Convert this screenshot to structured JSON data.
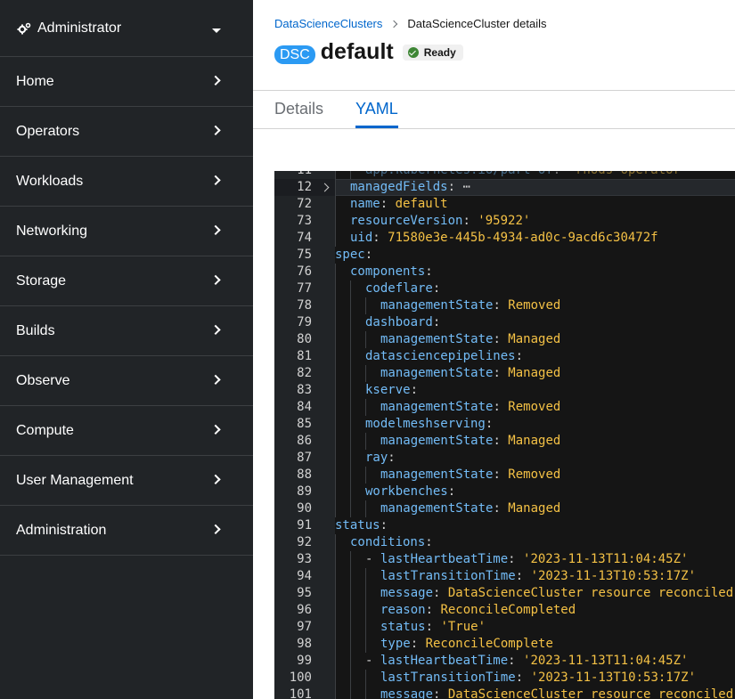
{
  "sidebar": {
    "perspective": "Administrator",
    "items": [
      {
        "label": "Home"
      },
      {
        "label": "Operators"
      },
      {
        "label": "Workloads"
      },
      {
        "label": "Networking"
      },
      {
        "label": "Storage"
      },
      {
        "label": "Builds"
      },
      {
        "label": "Observe"
      },
      {
        "label": "Compute"
      },
      {
        "label": "User Management"
      },
      {
        "label": "Administration"
      }
    ]
  },
  "breadcrumb": {
    "parent": "DataScienceClusters",
    "current": "DataScienceCluster details"
  },
  "header": {
    "badge": "DSC",
    "title": "default",
    "status": "Ready"
  },
  "tabs": [
    {
      "label": "Details",
      "active": false
    },
    {
      "label": "YAML",
      "active": true
    }
  ],
  "yaml": {
    "lines": [
      {
        "num": "11",
        "indent": 2,
        "key": "app.kubernetes.io/part-of",
        "value": "'rhods-operator'",
        "type": "string",
        "partial": true
      },
      {
        "num": "12",
        "indent": 1,
        "key": "managedFields",
        "value": "⋯",
        "type": "plain",
        "folded": true,
        "highlight": true
      },
      {
        "num": "72",
        "indent": 1,
        "key": "name",
        "value": "default",
        "type": "string"
      },
      {
        "num": "73",
        "indent": 1,
        "key": "resourceVersion",
        "value": "'95922'",
        "type": "string"
      },
      {
        "num": "74",
        "indent": 1,
        "key": "uid",
        "value": "71580e3e-445b-4934-ad0c-9acd6c30472f",
        "type": "string"
      },
      {
        "num": "75",
        "indent": 0,
        "key": "spec",
        "value": "",
        "type": "none"
      },
      {
        "num": "76",
        "indent": 1,
        "key": "components",
        "value": "",
        "type": "none"
      },
      {
        "num": "77",
        "indent": 2,
        "key": "codeflare",
        "value": "",
        "type": "none"
      },
      {
        "num": "78",
        "indent": 3,
        "key": "managementState",
        "value": "Removed",
        "type": "string"
      },
      {
        "num": "79",
        "indent": 2,
        "key": "dashboard",
        "value": "",
        "type": "none"
      },
      {
        "num": "80",
        "indent": 3,
        "key": "managementState",
        "value": "Managed",
        "type": "string"
      },
      {
        "num": "81",
        "indent": 2,
        "key": "datasciencepipelines",
        "value": "",
        "type": "none"
      },
      {
        "num": "82",
        "indent": 3,
        "key": "managementState",
        "value": "Managed",
        "type": "string"
      },
      {
        "num": "83",
        "indent": 2,
        "key": "kserve",
        "value": "",
        "type": "none"
      },
      {
        "num": "84",
        "indent": 3,
        "key": "managementState",
        "value": "Removed",
        "type": "string"
      },
      {
        "num": "85",
        "indent": 2,
        "key": "modelmeshserving",
        "value": "",
        "type": "none"
      },
      {
        "num": "86",
        "indent": 3,
        "key": "managementState",
        "value": "Managed",
        "type": "string"
      },
      {
        "num": "87",
        "indent": 2,
        "key": "ray",
        "value": "",
        "type": "none"
      },
      {
        "num": "88",
        "indent": 3,
        "key": "managementState",
        "value": "Removed",
        "type": "string"
      },
      {
        "num": "89",
        "indent": 2,
        "key": "workbenches",
        "value": "",
        "type": "none"
      },
      {
        "num": "90",
        "indent": 3,
        "key": "managementState",
        "value": "Managed",
        "type": "string"
      },
      {
        "num": "91",
        "indent": 0,
        "key": "status",
        "value": "",
        "type": "none"
      },
      {
        "num": "92",
        "indent": 1,
        "key": "conditions",
        "value": "",
        "type": "none"
      },
      {
        "num": "93",
        "indent": 2,
        "dash": true,
        "key": "lastHeartbeatTime",
        "value": "'2023-11-13T11:04:45Z'",
        "type": "string"
      },
      {
        "num": "94",
        "indent": 3,
        "key": "lastTransitionTime",
        "value": "'2023-11-13T10:53:17Z'",
        "type": "string"
      },
      {
        "num": "95",
        "indent": 3,
        "key": "message",
        "value": "DataScienceCluster resource reconciled",
        "type": "string"
      },
      {
        "num": "96",
        "indent": 3,
        "key": "reason",
        "value": "ReconcileCompleted",
        "type": "string"
      },
      {
        "num": "97",
        "indent": 3,
        "key": "status",
        "value": "'True'",
        "type": "string"
      },
      {
        "num": "98",
        "indent": 3,
        "key": "type",
        "value": "ReconcileComplete",
        "type": "string"
      },
      {
        "num": "99",
        "indent": 2,
        "dash": true,
        "key": "lastHeartbeatTime",
        "value": "'2023-11-13T11:04:45Z'",
        "type": "string"
      },
      {
        "num": "100",
        "indent": 3,
        "key": "lastTransitionTime",
        "value": "'2023-11-13T10:53:17Z'",
        "type": "string"
      },
      {
        "num": "101",
        "indent": 3,
        "key": "message",
        "value": "DataScienceCluster resource reconciled",
        "type": "string"
      }
    ]
  },
  "colors": {
    "sidebar_bg": "#212427",
    "link": "#0066cc",
    "yaml_key": "#73bcf7",
    "yaml_value": "#f4c145",
    "ready": "#3e8635"
  }
}
